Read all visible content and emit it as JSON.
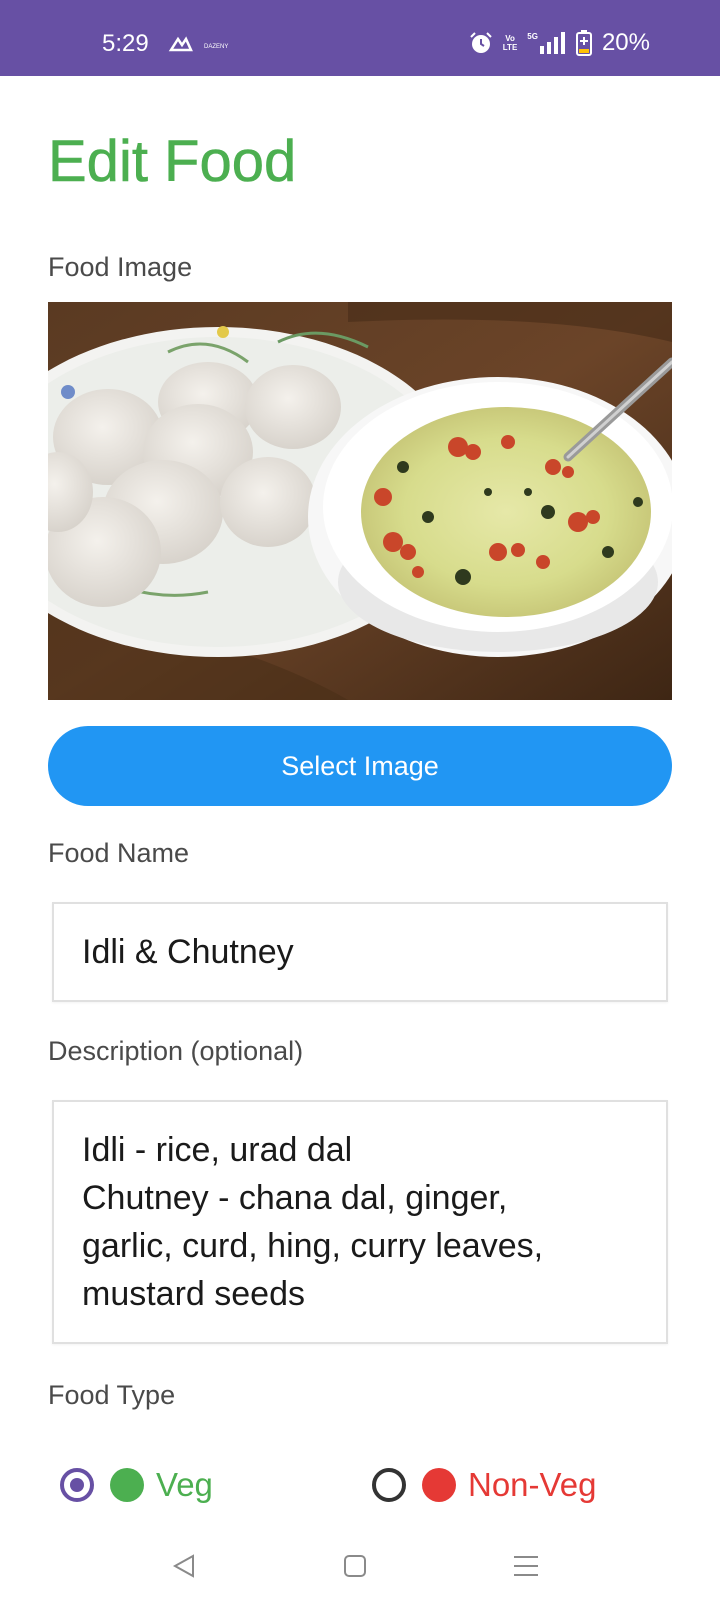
{
  "status_bar": {
    "time": "5:29",
    "notif_small": "DAZENY",
    "volte": "Vo\nLTE",
    "network": "5G",
    "battery": "20%"
  },
  "page": {
    "title": "Edit Food"
  },
  "food_image": {
    "label": "Food Image",
    "select_button": "Select Image"
  },
  "food_name": {
    "label": "Food Name",
    "value": "Idli & Chutney"
  },
  "description": {
    "label": "Description (optional)",
    "value": "Idli - rice, urad dal\nChutney - chana dal, ginger,\ngarlic, curd, hing, curry leaves,\nmustard seeds"
  },
  "food_type": {
    "label": "Food Type",
    "options": [
      {
        "label": "Veg",
        "selected": true,
        "color": "#4CAF50"
      },
      {
        "label": "Non-Veg",
        "selected": false,
        "color": "#E53935"
      }
    ]
  },
  "colors": {
    "accent": "#6750A4",
    "title_green": "#4CAF50",
    "button_blue": "#2196F3",
    "nonveg_red": "#E53935"
  },
  "icons": [
    "alarm-icon",
    "signal-icon",
    "battery-icon",
    "back-icon",
    "home-icon",
    "recents-icon"
  ]
}
